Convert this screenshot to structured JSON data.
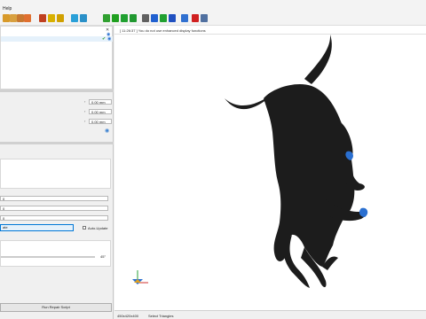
{
  "menubar": {
    "help_label": "Help"
  },
  "toolbar": {
    "icons": [
      {
        "name": "new-doc-icon",
        "color": "#d89a2a"
      },
      {
        "name": "open-icon",
        "color": "#d8a040"
      },
      {
        "name": "save-icon",
        "color": "#c87830"
      },
      {
        "name": "print-icon",
        "color": "#e07030"
      },
      {
        "name": "globe-icon",
        "color": "#c04020"
      },
      {
        "name": "arrow-left-icon",
        "color": "#d8b000"
      },
      {
        "name": "zoom-icon",
        "color": "#d0a000"
      },
      {
        "name": "select-icon",
        "color": "#2aa0d8"
      },
      {
        "name": "select-region-icon",
        "color": "#2a90c8"
      },
      {
        "name": "fill-icon",
        "color": "#30a030"
      },
      {
        "name": "paint-icon",
        "color": "#20a020"
      },
      {
        "name": "triangle-green-icon",
        "color": "#20a030"
      },
      {
        "name": "triangle-green2-icon",
        "color": "#209830"
      },
      {
        "name": "triangle-gray-icon",
        "color": "#606060"
      },
      {
        "name": "triangle-blue-icon",
        "color": "#2060d0"
      },
      {
        "name": "triangle-green3-icon",
        "color": "#20a030"
      },
      {
        "name": "triangle-blue2-icon",
        "color": "#2050c0"
      },
      {
        "name": "triangle-blue3-icon",
        "color": "#3070d0"
      },
      {
        "name": "cross-icon",
        "color": "#d02020"
      },
      {
        "name": "settings-dropdown-icon",
        "color": "#5070a0"
      }
    ]
  },
  "log": {
    "message": "[ 11:26:37 ] You do not use enhanced display functions"
  },
  "transform": {
    "rows": [
      {
        "value": "0.00 mm"
      },
      {
        "value": "0.00 mm"
      },
      {
        "value": "0.00 mm"
      }
    ]
  },
  "repair": {
    "inputs": [
      "0",
      "0",
      "0"
    ],
    "update_label": "ate",
    "auto_update_label": "Auto-Update",
    "angle_label": "45°",
    "run_script_label": "Run Repair Script"
  },
  "status": {
    "resolution": "450x420x400",
    "mode": "Select Triangles"
  },
  "colors": {
    "model": "#1c1c1c",
    "accent": "#0078d7",
    "highlight_blue": "#2a6fd0"
  }
}
